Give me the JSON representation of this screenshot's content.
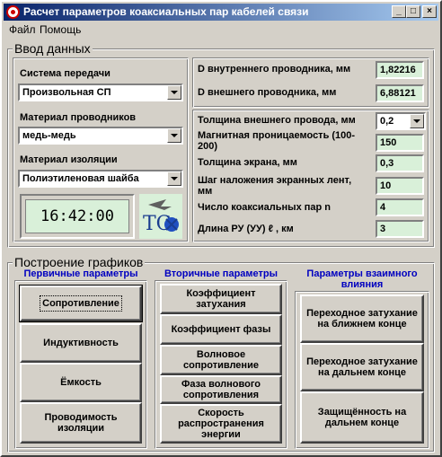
{
  "window": {
    "title": "Расчет параметров коаксиальных пар кабелей связи",
    "minimize": "_",
    "maximize": "□",
    "close": "×"
  },
  "menu": {
    "file": "Файл",
    "help": "Помощь"
  },
  "input": {
    "group_title": "Ввод данных",
    "system_label": "Система передачи",
    "system_value": "Произвольная СП",
    "material_label": "Материал проводников",
    "material_value": "медь-медь",
    "insulation_label": "Материал изоляции",
    "insulation_value": "Полиэтиленовая шайба",
    "clock": "16:42:00",
    "d_inner_label": "D внутреннего проводника, мм",
    "d_inner_value": "1,82216",
    "d_outer_label": "D внешнего проводника, мм",
    "d_outer_value": "6,88121",
    "wire_thickness_label": "Толщина внешнего провода, мм",
    "wire_thickness_value": "0,2",
    "permeability_label": "Магнитная проницаемость (100-200)",
    "permeability_value": "150",
    "screen_thickness_label": "Толщина экрана, мм",
    "screen_thickness_value": "0,3",
    "tape_step_label": "Шаг наложения экранных лент, мм",
    "tape_step_value": "10",
    "pairs_label": "Число коаксиальных пар n",
    "pairs_value": "4",
    "length_label": "Длина РУ (УУ)  ℓ , км",
    "length_value": "3",
    "logo_text": "TC"
  },
  "graphs": {
    "group_title": "Построение графиков",
    "primary": {
      "title": "Первичные параметры",
      "buttons": [
        "Сопротивление",
        "Индуктивность",
        "Ёмкость",
        "Проводимость изоляции"
      ]
    },
    "secondary": {
      "title": "Вторичные параметры",
      "buttons": [
        "Коэффициент затухания",
        "Коэффициент фазы",
        "Волновое сопротивление",
        "Фаза волнового сопротивления",
        "Скорость распространения энергии"
      ]
    },
    "mutual": {
      "title": "Параметры взаимного влияния",
      "buttons": [
        "Переходное затухание на ближнем конце",
        "Переходное затухание на дальнем конце",
        "Защищённость на дальнем конце"
      ]
    }
  }
}
